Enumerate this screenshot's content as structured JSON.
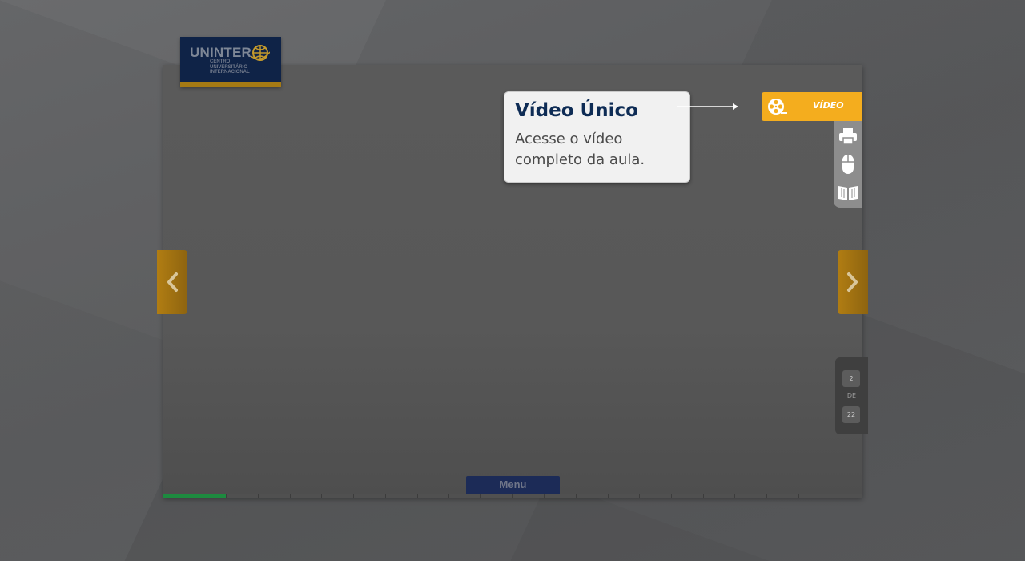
{
  "logo": {
    "word": "UNINTER",
    "subtitle_lines": [
      "CENTRO",
      "UNIVERSITÁRIO",
      "INTERNACIONAL"
    ],
    "colors": {
      "background": "#0f2347",
      "accent": "#a57a14"
    }
  },
  "tooltip": {
    "title": "Vídeo Único",
    "text": "Acesse o vídeo completo da aula."
  },
  "toolbar": {
    "video_label": "VÍDEO",
    "video_icon": "film-reel-icon",
    "tools": [
      {
        "name": "print-icon"
      },
      {
        "name": "mouse-icon"
      },
      {
        "name": "book-icon"
      }
    ],
    "colors": {
      "video_button": "#f4ad1e",
      "tools_panel": "#8d8d8d"
    }
  },
  "navigation": {
    "prev_icon": "chevron-left-icon",
    "next_icon": "chevron-right-icon",
    "color": "#b17d12"
  },
  "pager": {
    "current": "2",
    "of_label": "DE",
    "total": "22"
  },
  "menu": {
    "label": "Menu"
  },
  "progress": {
    "completed_segments": 2,
    "total_segments": 22,
    "color": "#1d8a3f"
  }
}
